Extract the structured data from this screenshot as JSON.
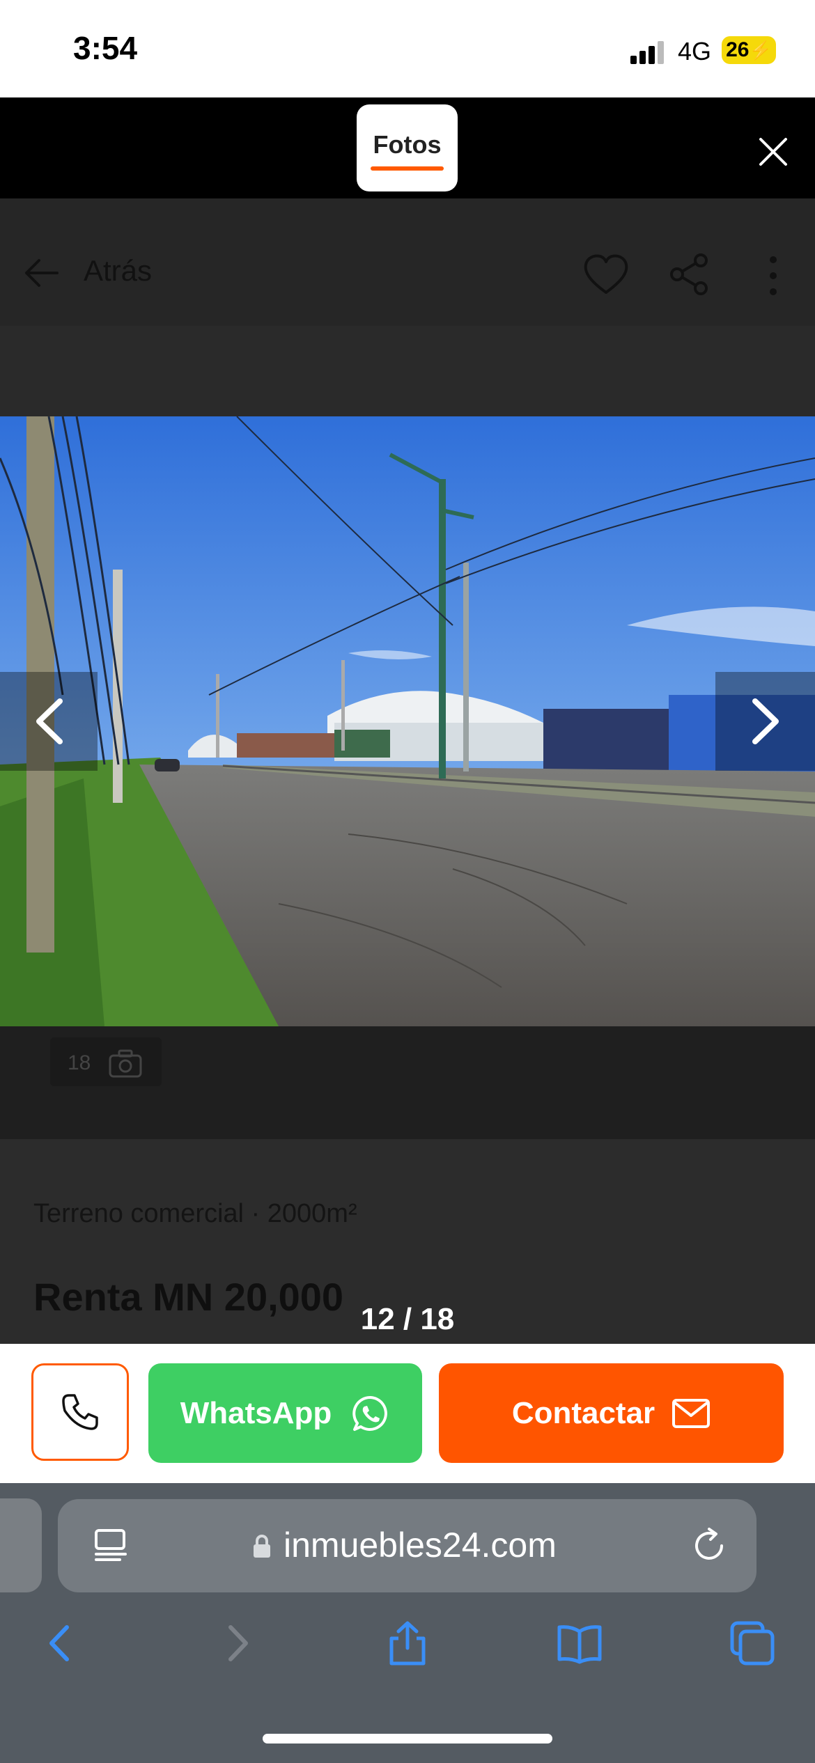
{
  "status_bar": {
    "time": "3:54",
    "network": "4G",
    "battery": "26"
  },
  "gallery_header": {
    "tab_label": "Fotos"
  },
  "page": {
    "back_label": "Atrás",
    "photo_count": "18",
    "property_type": "Terreno comercial · 2000m²",
    "price": "Renta MN 20,000"
  },
  "gallery": {
    "counter": "12 / 18"
  },
  "actions": {
    "whatsapp_label": "WhatsApp",
    "contact_label": "Contactar"
  },
  "browser": {
    "url": "inmuebles24.com"
  },
  "colors": {
    "accent": "#ff5500",
    "whatsapp": "#3ecf63",
    "safari_blue": "#3a8ef6"
  },
  "icons": [
    "close-icon",
    "back-arrow-icon",
    "heart-icon",
    "share-icon",
    "more-icon",
    "chevron-left-icon",
    "chevron-right-icon",
    "camera-icon",
    "phone-icon",
    "whatsapp-icon",
    "mail-icon",
    "reader-icon",
    "lock-icon",
    "reload-icon",
    "back-icon",
    "forward-icon",
    "share-icon",
    "bookmarks-icon",
    "tabs-icon"
  ]
}
